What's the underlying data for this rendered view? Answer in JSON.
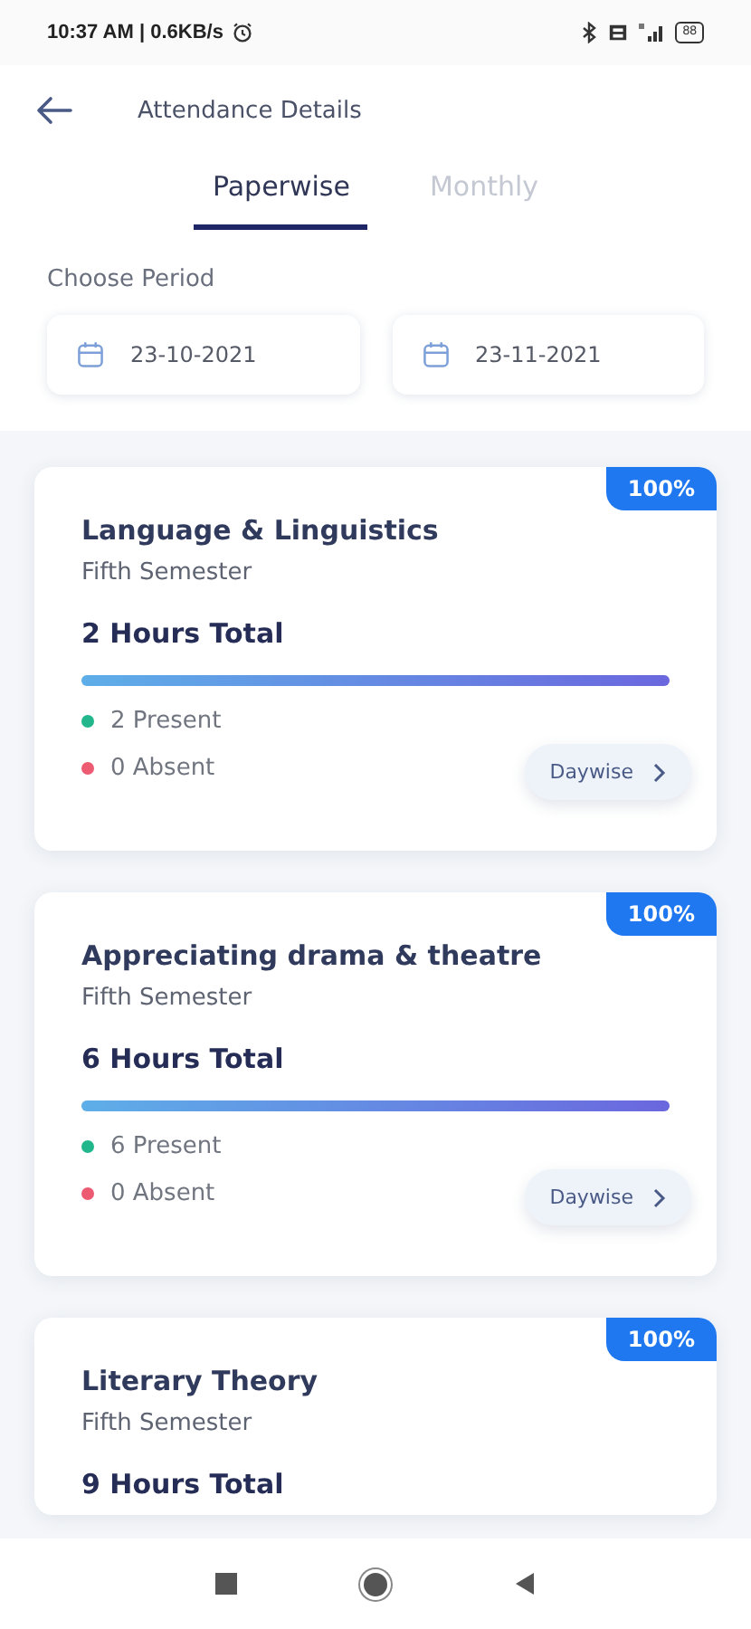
{
  "status_bar": {
    "time": "10:37 AM | 0.6KB/s",
    "battery": "88"
  },
  "header": {
    "title": "Attendance Details"
  },
  "tabs": [
    {
      "label": "Paperwise",
      "selected": true
    },
    {
      "label": "Monthly",
      "selected": false
    }
  ],
  "period": {
    "label": "Choose Period",
    "from": "23-10-2021",
    "to": "23-11-2021"
  },
  "cards": [
    {
      "badge": "100%",
      "title": "Language & Linguistics",
      "semester": "Fifth Semester",
      "total": "2 Hours Total",
      "level": 1,
      "present": "2 Present",
      "absent": "0 Absent",
      "button": "Daywise"
    },
    {
      "badge": "100%",
      "title": "Appreciating drama & theatre",
      "semester": "Fifth Semester",
      "total": "6 Hours Total",
      "level": 1,
      "present": "6 Present",
      "absent": "0 Absent",
      "button": "Daywise"
    },
    {
      "badge": "100%",
      "title": "Literary Theory",
      "semester": "Fifth Semester",
      "total": "9 Hours Total"
    }
  ]
}
